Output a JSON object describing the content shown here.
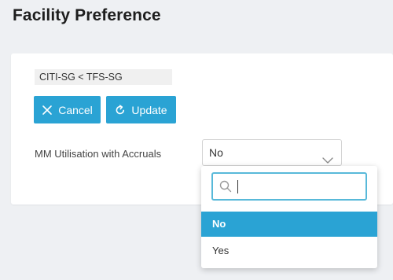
{
  "page": {
    "title": "Facility Preference"
  },
  "card": {
    "facility_tag": "CITI-SG < TFS-SG",
    "buttons": {
      "cancel_label": "Cancel",
      "update_label": "Update",
      "cancel_icon": "close-icon",
      "update_icon": "refresh-icon"
    },
    "field": {
      "label": "MM Utilisation with Accruals",
      "selected_value": "No"
    }
  },
  "dropdown": {
    "search_placeholder": "",
    "search_value": "",
    "options": [
      {
        "label": "No",
        "selected": true
      },
      {
        "label": "Yes",
        "selected": false
      }
    ]
  },
  "colors": {
    "accent": "#2aa3d4",
    "search_border": "#58b9d9",
    "background": "#eef0f3"
  }
}
